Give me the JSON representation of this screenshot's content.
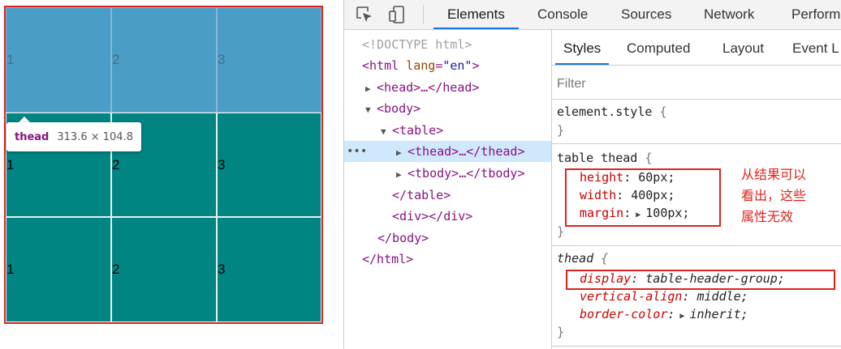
{
  "table": {
    "head_rows": [
      [
        "1",
        "2",
        "3"
      ]
    ],
    "body_rows": [
      [
        "1",
        "2",
        "3"
      ],
      [
        "1",
        "2",
        "3"
      ]
    ]
  },
  "tooltip": {
    "tag": "thead",
    "dims": "313.6 × 104.8"
  },
  "devtools": {
    "tabs": [
      "Elements",
      "Console",
      "Sources",
      "Network",
      "Perform"
    ],
    "active_tab": "Elements",
    "icons": [
      "inspect-element-icon",
      "device-toolbar-icon"
    ],
    "elements_tree": {
      "doctype": "<!DOCTYPE html>",
      "html_open": "<html",
      "html_attr_name": "lang",
      "html_attr_value": "\"en\"",
      "html_close_bracket": ">",
      "head": "<head>…</head>",
      "body_open": "<body>",
      "table_open": "<table>",
      "thead": "<thead>…</thead>",
      "tbody": "<tbody>…</tbody>",
      "table_close": "</table>",
      "div": "<div></div>",
      "body_close": "</body>",
      "html_close": "</html>",
      "selected_marker": "…"
    },
    "styles": {
      "tabs": [
        "Styles",
        "Computed",
        "Layout",
        "Event L"
      ],
      "active_tab": "Styles",
      "filter_placeholder": "Filter",
      "element_style_selector": "element.style",
      "rule1_selector": "table thead",
      "rule1_props": [
        {
          "name": "height",
          "value": "60px;"
        },
        {
          "name": "width",
          "value": "400px;"
        },
        {
          "name": "margin",
          "value": "100px;"
        }
      ],
      "rule2_selector": "thead",
      "rule2_props": [
        {
          "name": "display",
          "value": "table-header-group;"
        },
        {
          "name": "vertical-align",
          "value": "middle;"
        },
        {
          "name": "border-color",
          "value": "inherit;"
        }
      ],
      "open_brace": "{",
      "close_brace": "}",
      "colon": ":"
    }
  },
  "annotation": {
    "lines": [
      "从结果可以",
      "看出，这些",
      "属性无效"
    ]
  },
  "colors": {
    "thead_bg": "#4a9dc6",
    "tbody_bg": "#008583",
    "highlight_red": "#e0221e",
    "active_tab_underline": "#1a73e8"
  }
}
